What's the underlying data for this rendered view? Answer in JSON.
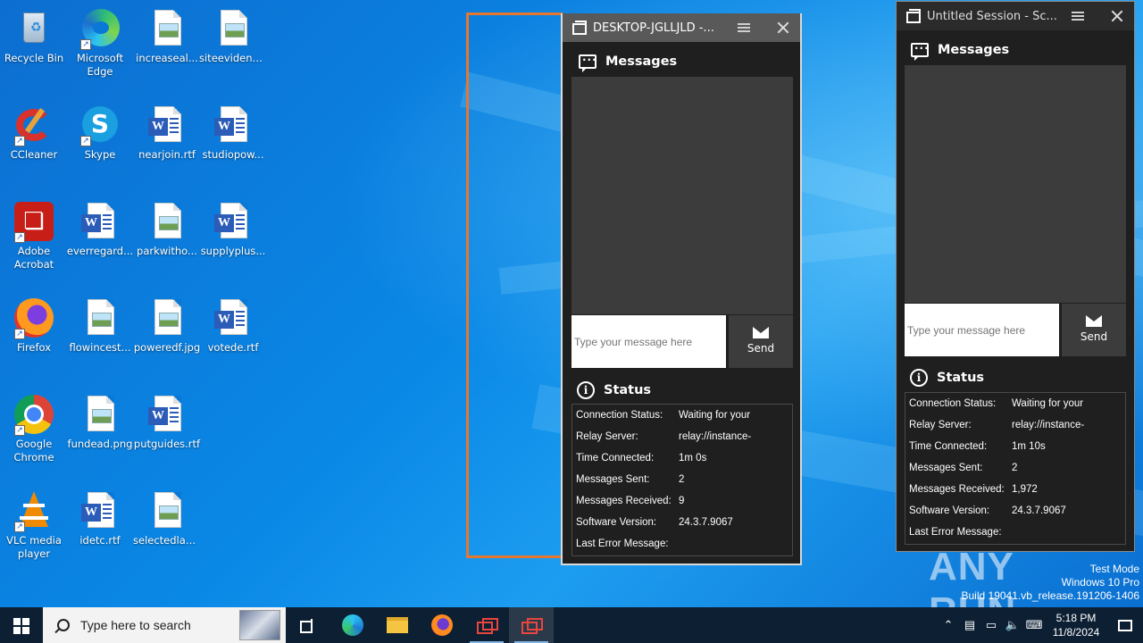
{
  "desktop": {
    "icons": [
      {
        "label": "Recycle Bin",
        "type": "recycle"
      },
      {
        "label": "Microsoft Edge",
        "type": "edge"
      },
      {
        "label": "increaseal...",
        "type": "image"
      },
      {
        "label": "siteevidenc...",
        "type": "image"
      },
      {
        "label": "CCleaner",
        "type": "ccleaner"
      },
      {
        "label": "Skype",
        "type": "skype"
      },
      {
        "label": "nearjoin.rtf",
        "type": "word"
      },
      {
        "label": "studiopow...",
        "type": "word"
      },
      {
        "label": "Adobe Acrobat",
        "type": "acrobat"
      },
      {
        "label": "everregard...",
        "type": "word"
      },
      {
        "label": "parkwitho...",
        "type": "image"
      },
      {
        "label": "supplyplus...",
        "type": "word"
      },
      {
        "label": "Firefox",
        "type": "firefox"
      },
      {
        "label": "flowincest...",
        "type": "image"
      },
      {
        "label": "poweredf.jpg",
        "type": "image"
      },
      {
        "label": "votede.rtf",
        "type": "word"
      },
      {
        "label": "Google Chrome",
        "type": "chrome"
      },
      {
        "label": "fundead.png",
        "type": "image"
      },
      {
        "label": "putguides.rtf",
        "type": "word"
      },
      {
        "label": "VLC media player",
        "type": "vlc"
      },
      {
        "label": "idetc.rtf",
        "type": "word"
      },
      {
        "label": "selectedlan...",
        "type": "image"
      }
    ]
  },
  "window_left": {
    "title": "DESKTOP-JGLLJLD -...",
    "messages_heading": "Messages",
    "input_placeholder": "Type your message here",
    "send_label": "Send",
    "status_heading": "Status",
    "status_rows": [
      {
        "key": "Connection Status:",
        "value": "Waiting for your"
      },
      {
        "key": "Relay Server:",
        "value": "relay://instance-"
      },
      {
        "key": "Time Connected:",
        "value": "1m 0s"
      },
      {
        "key": "Messages Sent:",
        "value": "2"
      },
      {
        "key": "Messages Received:",
        "value": "9"
      },
      {
        "key": "Software Version:",
        "value": "24.3.7.9067"
      },
      {
        "key": "Last Error Message:",
        "value": ""
      }
    ]
  },
  "window_right": {
    "title": "Untitled Session - Sc...",
    "messages_heading": "Messages",
    "input_placeholder": "Type your message here",
    "send_label": "Send",
    "status_heading": "Status",
    "status_rows": [
      {
        "key": "Connection Status:",
        "value": "Waiting for your"
      },
      {
        "key": "Relay Server:",
        "value": "relay://instance-"
      },
      {
        "key": "Time Connected:",
        "value": "1m 10s"
      },
      {
        "key": "Messages Sent:",
        "value": "2"
      },
      {
        "key": "Messages Received:",
        "value": "1,972"
      },
      {
        "key": "Software Version:",
        "value": "24.3.7.9067"
      },
      {
        "key": "Last Error Message:",
        "value": ""
      }
    ]
  },
  "taskbar": {
    "search_placeholder": "Type here to search",
    "time": "5:18 PM",
    "date": "11/8/2024"
  },
  "watermark": {
    "brand": "ANY RUN",
    "test_mode": "Test Mode",
    "os": "Windows 10 Pro",
    "build": "Build 19041.vb_release.191206-1406"
  }
}
